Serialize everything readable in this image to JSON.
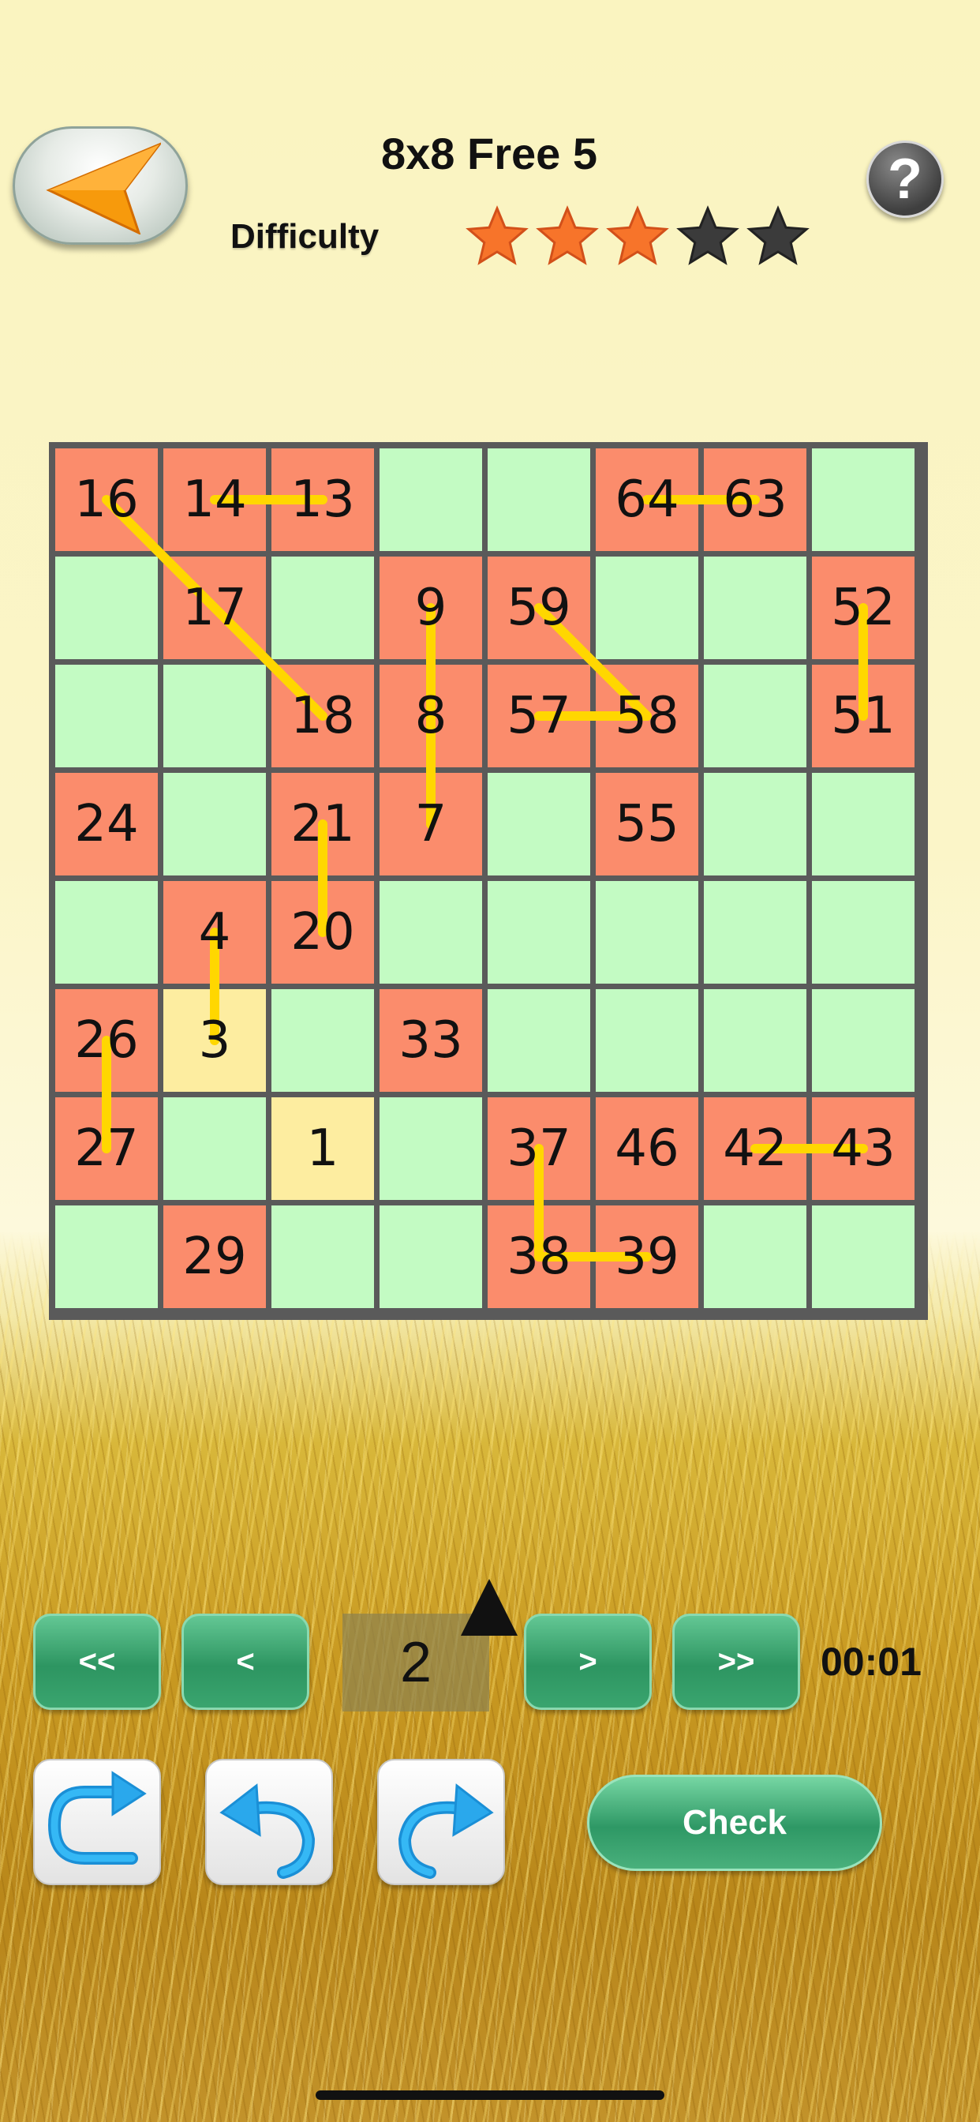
{
  "header": {
    "title": "8x8 Free 5",
    "difficulty_label": "Difficulty",
    "difficulty_stars": 3,
    "difficulty_max": 5,
    "help_label": "?",
    "back_icon": "orange-arrow-left-icon"
  },
  "board": {
    "size": 8,
    "cells": [
      [
        "16",
        "14",
        "13",
        "",
        "",
        "64",
        "63",
        ""
      ],
      [
        "",
        "17",
        "",
        "9",
        "59",
        "",
        "",
        "52"
      ],
      [
        "",
        "",
        "18",
        "8",
        "57",
        "58",
        "",
        "51"
      ],
      [
        "24",
        "",
        "21",
        "7",
        "",
        "55",
        "",
        ""
      ],
      [
        "",
        "4",
        "20",
        "",
        "",
        "",
        "",
        ""
      ],
      [
        "26",
        "3",
        "",
        "33",
        "",
        "",
        "",
        ""
      ],
      [
        "27",
        "",
        "1",
        "",
        "37",
        "46",
        "42",
        "43"
      ],
      [
        "",
        "29",
        "",
        "",
        "38",
        "39",
        "",
        ""
      ]
    ],
    "highlighted": [
      "3",
      "1"
    ],
    "links": [
      [
        "14",
        "13"
      ],
      [
        "64",
        "63"
      ],
      [
        "16",
        "18"
      ],
      [
        "9",
        "7"
      ],
      [
        "59",
        "58"
      ],
      [
        "57",
        "58"
      ],
      [
        "52",
        "51"
      ],
      [
        "21",
        "20"
      ],
      [
        "4",
        "3"
      ],
      [
        "26",
        "27"
      ],
      [
        "42",
        "43"
      ],
      [
        "37",
        "38"
      ],
      [
        "38",
        "39"
      ]
    ],
    "colors": {
      "empty": "#c3fbc3",
      "filled": "#fb8c6c",
      "highlight": "#fdeda0",
      "link": "#ffd700"
    }
  },
  "controls": {
    "first_label": "<<",
    "prev_label": "<",
    "current_number": "2",
    "next_label": ">",
    "last_label": ">>",
    "timer": "00:01",
    "redo_all_icon": "loop-arrow-icon",
    "undo_icon": "undo-arrow-icon",
    "redo_icon": "redo-arrow-icon",
    "check_label": "Check"
  }
}
